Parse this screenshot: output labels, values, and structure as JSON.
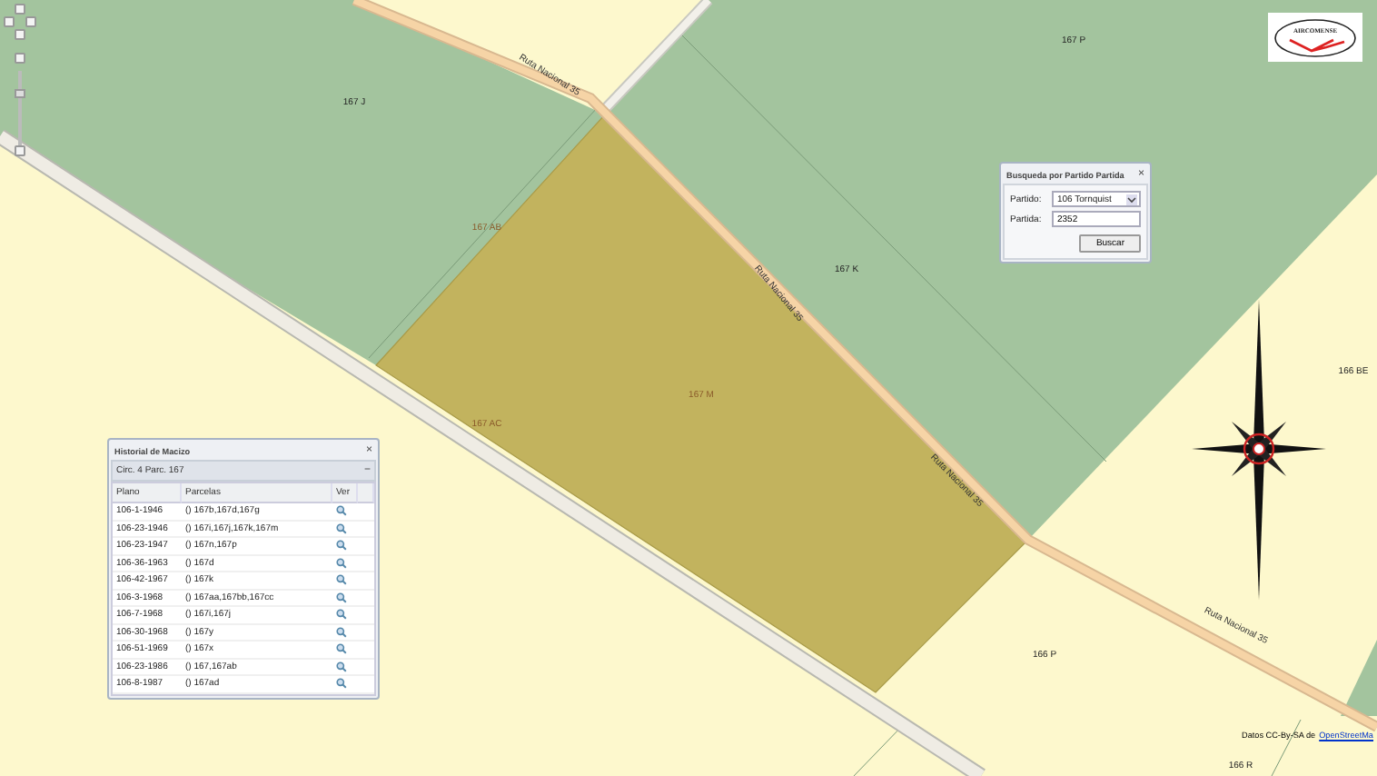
{
  "map": {
    "parcel_labels": [
      "167 P",
      "167 J",
      "167 AB",
      "167 K",
      "167 M",
      "167 AC",
      "166 BE",
      "166 P",
      "166 R"
    ],
    "road_labels": [
      "Ruta Nacional 35",
      "Ruta Nacional 35",
      "Ruta Nacional 35",
      "Ruta Nacional 35"
    ]
  },
  "zoom": {
    "level": 0.74
  },
  "logo": {
    "text": "AIRCOMENSE"
  },
  "search_panel": {
    "title": "Busqueda por Partido Partida",
    "close": "×",
    "fields": [
      {
        "kind": "select",
        "label": "Partido:",
        "value": "106 Tornquist"
      },
      {
        "kind": "text",
        "label": "Partida:",
        "value": "2352"
      }
    ],
    "button": "Buscar"
  },
  "history_panel": {
    "title": "Historial de Macizo",
    "close": "×",
    "subtitle": "Circ. 4 Parc. 167",
    "collapse": "−",
    "columns": [
      "Plano",
      "Parcelas",
      "Ver"
    ],
    "rows": [
      {
        "plano": "106-1-1946",
        "parcelas": "() 167b,167d,167g"
      },
      {
        "plano": "106-23-1946",
        "parcelas": "() 167i,167j,167k,167m"
      },
      {
        "plano": "106-23-1947",
        "parcelas": "() 167n,167p"
      },
      {
        "plano": "106-36-1963",
        "parcelas": "() 167d"
      },
      {
        "plano": "106-42-1967",
        "parcelas": "() 167k"
      },
      {
        "plano": "106-3-1968",
        "parcelas": "() 167aa,167bb,167cc"
      },
      {
        "plano": "106-7-1968",
        "parcelas": "() 167i,167j"
      },
      {
        "plano": "106-30-1968",
        "parcelas": "() 167y"
      },
      {
        "plano": "106-51-1969",
        "parcelas": "() 167x"
      },
      {
        "plano": "106-23-1986",
        "parcelas": "() 167,167ab"
      },
      {
        "plano": "106-8-1987",
        "parcelas": "() 167ad"
      }
    ]
  },
  "attribution": {
    "text": "Datos CC-By-SA de",
    "link": "OpenStreetMa"
  }
}
